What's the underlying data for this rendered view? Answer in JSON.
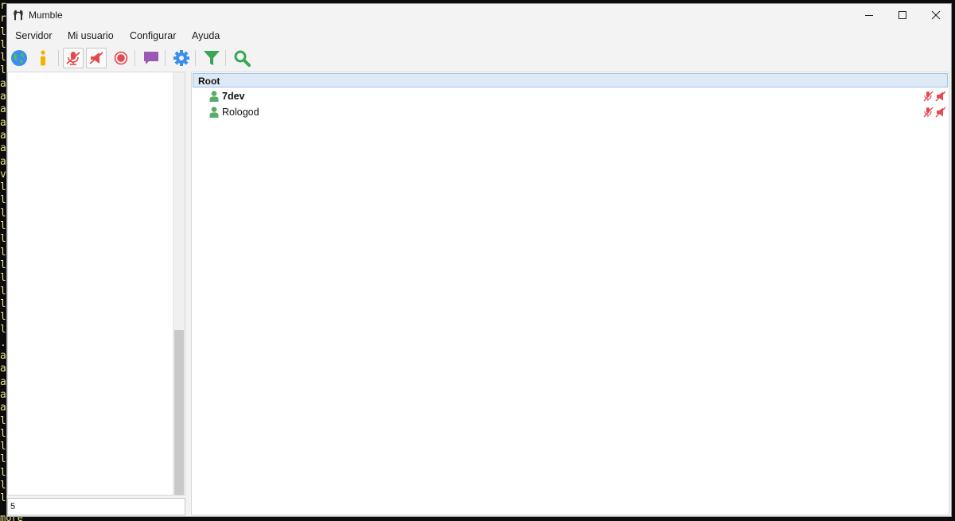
{
  "window": {
    "title": "Mumble"
  },
  "menu": {
    "items": [
      "Servidor",
      "Mi usuario",
      "Configurar",
      "Ayuda"
    ]
  },
  "toolbar": {
    "buttons": [
      {
        "icon": "globe-icon"
      },
      {
        "icon": "info-icon"
      },
      {
        "icon": "mute-self-icon",
        "pressed": true
      },
      {
        "icon": "deafen-self-icon",
        "pressed": true
      },
      {
        "icon": "record-icon"
      },
      {
        "icon": "chat-bubble-icon"
      },
      {
        "icon": "gear-icon"
      },
      {
        "icon": "filter-icon"
      },
      {
        "icon": "search-icon"
      }
    ]
  },
  "chat": {
    "input_value": "5"
  },
  "tree": {
    "root": "Root",
    "users": [
      {
        "name": "7dev",
        "bold": true,
        "self_muted": true,
        "self_deafened": true
      },
      {
        "name": "Rologod",
        "bold": false,
        "self_muted": true,
        "self_deafened": true
      }
    ]
  },
  "background_terminal": {
    "left_chars": [
      "r",
      "r",
      "l",
      "l",
      "l",
      "l",
      "a",
      "a",
      "a",
      "a",
      "a",
      "a",
      "a",
      "v",
      "l",
      "l",
      "l",
      "l",
      "l",
      "l",
      "l",
      "l",
      "l",
      "l",
      "l",
      "l",
      ".",
      "a",
      "a",
      "a",
      "a",
      "a",
      "l",
      "l",
      "l",
      "l",
      "l",
      "l",
      "l"
    ],
    "bottom_text": "more"
  },
  "colors": {
    "accent_blue": "#3b8eea",
    "mute_red": "#e5484d",
    "user_green": "#5aad68",
    "filter_green": "#3aa655",
    "chat_purple": "#9b59b6",
    "root_highlight": "#dde9f5"
  }
}
